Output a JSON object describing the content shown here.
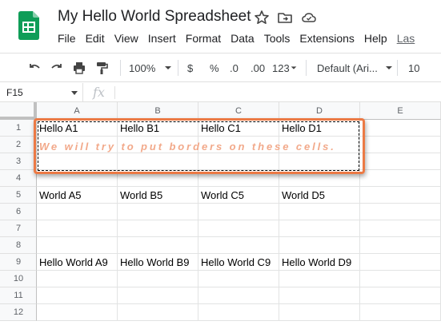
{
  "app": {
    "title": "My Hello World Spreadsheet",
    "menu": [
      "File",
      "Edit",
      "View",
      "Insert",
      "Format",
      "Data",
      "Tools",
      "Extensions",
      "Help"
    ],
    "last_edit": "Las"
  },
  "toolbar": {
    "zoom": "100%",
    "currency": "$",
    "percent": "%",
    "decrease_decimal": ".0",
    "increase_decimal": ".00",
    "more_formats": "123",
    "font": "Default (Ari...",
    "font_size": "10"
  },
  "formula_bar": {
    "cell_ref": "F15",
    "fx": "fx",
    "value": ""
  },
  "grid": {
    "columns": [
      "A",
      "B",
      "C",
      "D",
      "E"
    ],
    "rows": [
      {
        "num": "1",
        "cells": [
          "Hello A1",
          "Hello B1",
          "Hello C1",
          "Hello D1",
          ""
        ]
      },
      {
        "num": "2",
        "cells": [
          "",
          "",
          "",
          "",
          ""
        ]
      },
      {
        "num": "3",
        "cells": [
          "",
          "",
          "",
          "",
          ""
        ]
      },
      {
        "num": "4",
        "cells": [
          "",
          "",
          "",
          "",
          ""
        ]
      },
      {
        "num": "5",
        "cells": [
          "World A5",
          "World B5",
          "World C5",
          "World D5",
          ""
        ]
      },
      {
        "num": "6",
        "cells": [
          "",
          "",
          "",
          "",
          ""
        ]
      },
      {
        "num": "7",
        "cells": [
          "",
          "",
          "",
          "",
          ""
        ]
      },
      {
        "num": "8",
        "cells": [
          "",
          "",
          "",
          "",
          ""
        ]
      },
      {
        "num": "9",
        "cells": [
          "Hello World A9",
          "Hello World B9",
          "Hello World C9",
          "Hello World D9",
          ""
        ]
      },
      {
        "num": "10",
        "cells": [
          "",
          "",
          "",
          "",
          ""
        ]
      },
      {
        "num": "11",
        "cells": [
          "",
          "",
          "",
          "",
          ""
        ]
      },
      {
        "num": "12",
        "cells": [
          "",
          "",
          "",
          "",
          ""
        ]
      }
    ]
  },
  "annotation": {
    "text": "We will try to put borders on these cells.",
    "color": "#ec7a45"
  },
  "colors": {
    "sheets_green": "#0f9d58",
    "header_bg": "#f8f9fa",
    "gridline": "#e2e3e3"
  }
}
